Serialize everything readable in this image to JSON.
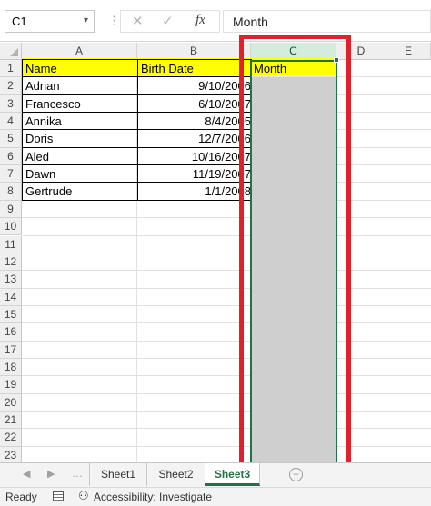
{
  "formula_bar": {
    "name_box": "C1",
    "name_box_arrow": "▾",
    "separator": "⋮",
    "cancel_icon": "✕",
    "enter_icon": "✓",
    "fx_label": "fx",
    "formula_value": "Month"
  },
  "grid": {
    "columns": [
      "A",
      "B",
      "C",
      "D",
      "E"
    ],
    "rows": [
      "1",
      "2",
      "3",
      "4",
      "5",
      "6",
      "7",
      "8",
      "9",
      "10",
      "11",
      "12",
      "13",
      "14",
      "15",
      "16",
      "17",
      "18",
      "19",
      "20",
      "21",
      "22",
      "23"
    ],
    "selected_column": "C",
    "headers": {
      "a1": "Name",
      "b1": "Birth Date",
      "c1": "Month"
    },
    "records": [
      {
        "name": "Adnan",
        "birth_date": "9/10/2006"
      },
      {
        "name": "Francesco",
        "birth_date": "6/10/2007"
      },
      {
        "name": "Annika",
        "birth_date": "8/4/2005"
      },
      {
        "name": "Doris",
        "birth_date": "12/7/2006"
      },
      {
        "name": "Aled",
        "birth_date": "10/16/2007"
      },
      {
        "name": "Dawn",
        "birth_date": "11/19/2007"
      },
      {
        "name": "Gertrude",
        "birth_date": "1/1/2008"
      }
    ],
    "header_fill_color": "#ffff00",
    "selection_color": "#217346",
    "annotation_color": "#e0202a"
  },
  "sheet_tabs": {
    "prev_icon": "◀",
    "next_icon": "▶",
    "more_icon": "…",
    "tabs": [
      "Sheet1",
      "Sheet2",
      "Sheet3"
    ],
    "active_tab": "Sheet3",
    "add_icon": "+"
  },
  "status_bar": {
    "ready": "Ready",
    "accessibility": "Accessibility: Investigate"
  }
}
